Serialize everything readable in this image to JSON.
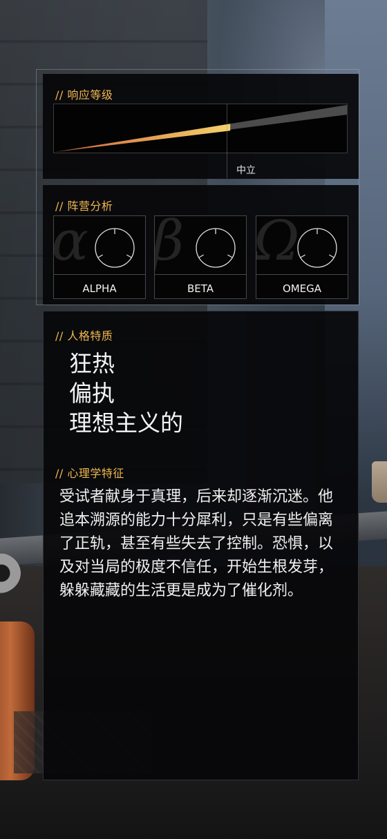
{
  "response_level": {
    "title": "// 响应等级",
    "value": 0.6,
    "midpoint_label": "中立",
    "colors": {
      "low": "#d2603a",
      "high": "#f3d36c",
      "remainder": "#4c4c4c"
    }
  },
  "factions": {
    "title": "// 阵营分析",
    "items": [
      {
        "name": "ALPHA",
        "glyph": "α"
      },
      {
        "name": "BETA",
        "glyph": "β"
      },
      {
        "name": "OMEGA",
        "glyph": "Ω"
      }
    ]
  },
  "traits": {
    "title": "// 人格特质",
    "items": [
      "狂热",
      "偏执",
      "理想主义的"
    ]
  },
  "psych": {
    "title": "// 心理学特征",
    "text": "受试者献身于真理，后来却逐渐沉迷。他追本溯源的能力十分犀利，只是有些偏离了正轨，甚至有些失去了控制。恐惧，以及对当局的极度不信任，开始生根发芽，躲躲藏藏的生活更是成为了催化剂。"
  },
  "accent_color": "#f0b850"
}
